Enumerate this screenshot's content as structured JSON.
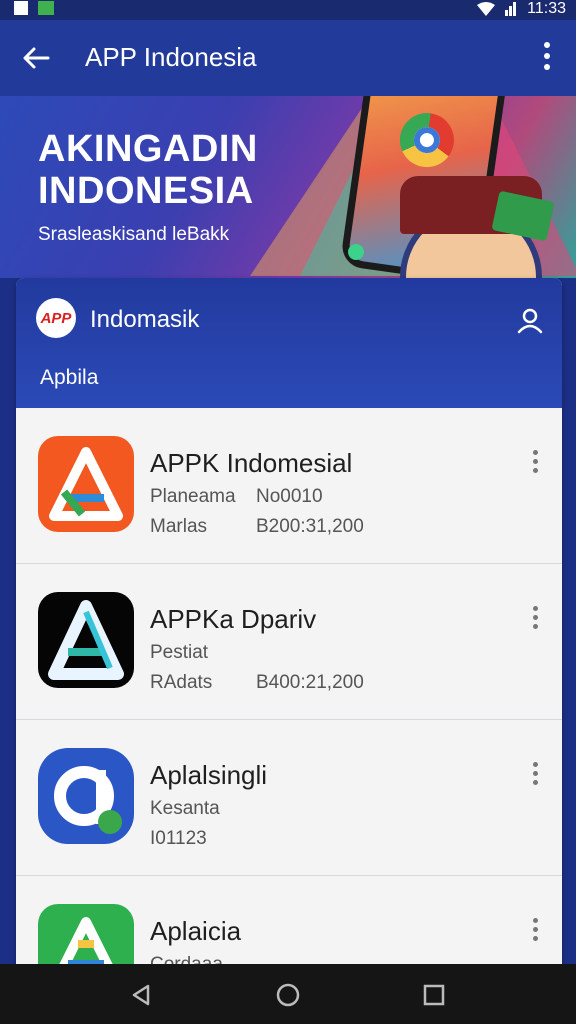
{
  "status_bar": {
    "time": "11:33",
    "left_icons": [
      "notification-icon",
      "app-icon"
    ],
    "right_icons": [
      "wifi-icon",
      "signal-icon"
    ]
  },
  "app_bar": {
    "title": "APP Indonesia",
    "back_icon": "back-arrow-icon",
    "menu_icon": "more-vert-icon"
  },
  "banner": {
    "headline_line1": "AKINGADIN",
    "headline_line2": "INDONESIA",
    "subtitle": "Srasleaskisand leBakk"
  },
  "card": {
    "brand_logo_text": "APP",
    "brand_name": "Indomasik",
    "section_label": "Apbila",
    "user_icon": "person-icon"
  },
  "apps": [
    {
      "title": "APPK Indomesial",
      "meta1_label": "Planeama",
      "meta1_value": "No0010",
      "meta2_label": "Marlas",
      "meta2_value": "B200:31,200",
      "icon": "orange-a-logo-icon"
    },
    {
      "title": "APPKa Dpariv",
      "meta1_label": "Pestiat",
      "meta1_value": "",
      "meta2_label": "RAdats",
      "meta2_value": "B400:21,200",
      "icon": "black-a-logo-icon"
    },
    {
      "title": "Aplalsingli",
      "meta1_label": "Kesanta",
      "meta1_value": "",
      "meta2_label": "I01123",
      "meta2_value": "",
      "icon": "blue-round-app-icon"
    },
    {
      "title": "Aplaicia",
      "meta1_label": "Cordaaa",
      "meta1_value": "",
      "meta2_label": "",
      "meta2_value": "",
      "icon": "green-a-logo-icon"
    }
  ],
  "nav_bar": {
    "back": "triangle-back-icon",
    "home": "circle-home-icon",
    "recents": "square-recents-icon"
  },
  "colors": {
    "primary": "#223a9a",
    "banner_gradient_start": "#2d4ab8",
    "card_bg": "#f4f4f5",
    "nav_bg": "#151515"
  }
}
